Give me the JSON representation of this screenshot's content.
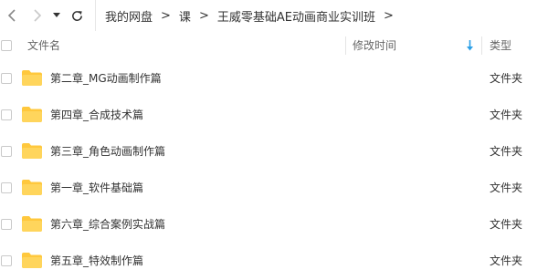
{
  "breadcrumb": [
    {
      "label": "我的网盘"
    },
    {
      "label": "课"
    },
    {
      "label": "王威零基础AE动画商业实训班"
    }
  ],
  "breadcrumb_separator": ">",
  "columns": {
    "name": "文件名",
    "modified": "修改时间",
    "type": "类型",
    "sort_direction": "descending"
  },
  "files": [
    {
      "name": "第二章_MG动画制作篇",
      "type": "文件夹"
    },
    {
      "name": "第四章_合成技术篇",
      "type": "文件夹"
    },
    {
      "name": "第三章_角色动画制作篇",
      "type": "文件夹"
    },
    {
      "name": "第一章_软件基础篇",
      "type": "文件夹"
    },
    {
      "name": "第六章_综合案例实战篇",
      "type": "文件夹"
    },
    {
      "name": "第五章_特效制作篇",
      "type": "文件夹"
    }
  ],
  "icons": {
    "back": "chevron-left-icon",
    "forward": "chevron-right-icon",
    "history": "caret-down-icon",
    "refresh": "refresh-icon",
    "sort": "arrow-down-icon",
    "folder": "folder-icon"
  },
  "colors": {
    "folder": "#ffc83d",
    "sort_arrow": "#2b9fe6"
  }
}
